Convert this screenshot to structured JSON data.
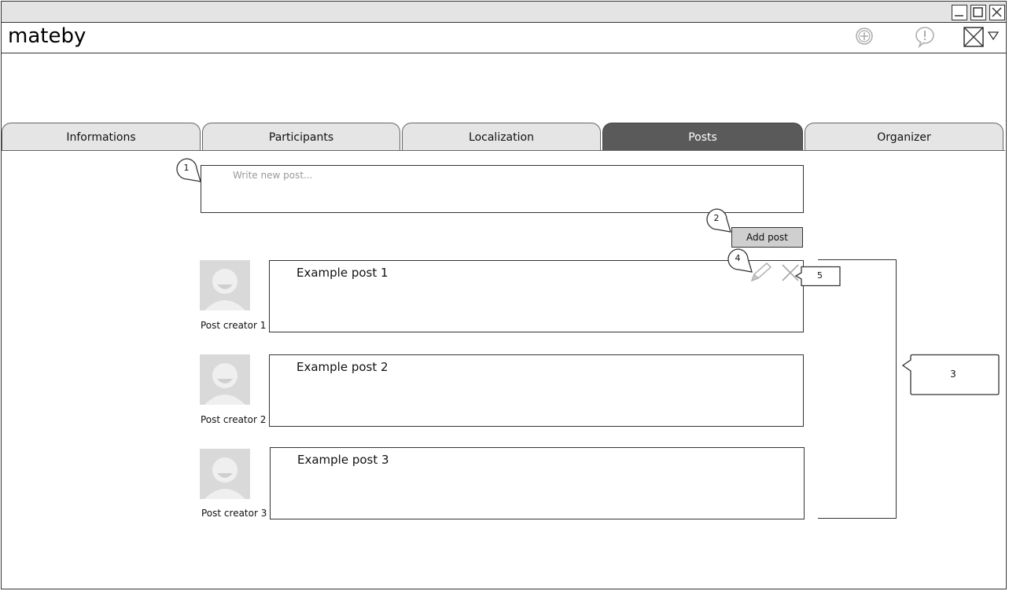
{
  "app": {
    "name": "mateby"
  },
  "window_controls": [
    "minimize-icon",
    "maximize-icon",
    "close-icon"
  ],
  "toolbar_icons": [
    "add-circle-icon",
    "alert-icon",
    "image-placeholder-icon",
    "chevron-down-icon"
  ],
  "tabs": [
    {
      "label": "Informations"
    },
    {
      "label": "Participants"
    },
    {
      "label": "Localization"
    },
    {
      "label": "Posts",
      "active": true
    },
    {
      "label": "Organizer"
    }
  ],
  "new_post": {
    "placeholder": "Write new post...",
    "add_label": "Add post"
  },
  "posts": [
    {
      "creator": "Post creator 1",
      "text": "Example post 1"
    },
    {
      "creator": "Post creator 2",
      "text": "Example post 2"
    },
    {
      "creator": "Post creator 3",
      "text": "Example post 3"
    }
  ],
  "callouts": {
    "c1": "1",
    "c2": "2",
    "c3": "3",
    "c4": "4",
    "c5": "5"
  },
  "colors": {
    "active_tab": "#5a5a5a",
    "tab": "#e5e5e5",
    "button": "#cfcfcf",
    "avatar": "#d9d9d9"
  }
}
